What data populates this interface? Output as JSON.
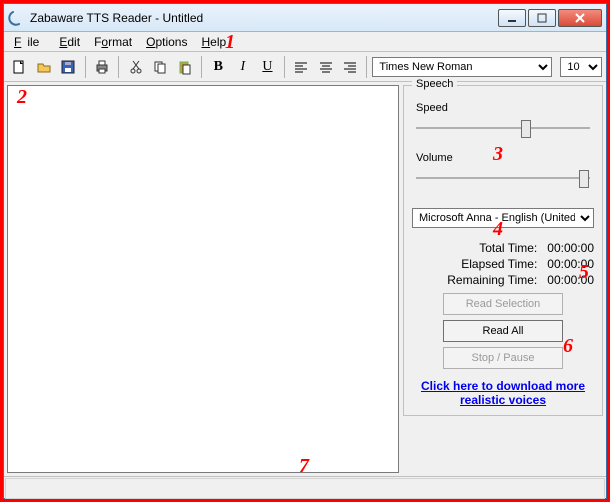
{
  "window": {
    "title": "Zabaware TTS Reader - Untitled"
  },
  "menu": {
    "file": "File",
    "edit": "Edit",
    "format": "Format",
    "options": "Options",
    "help": "Help"
  },
  "toolbar": {
    "font_value": "Times New Roman",
    "size_value": "10"
  },
  "speech": {
    "legend": "Speech",
    "speed_label": "Speed",
    "volume_label": "Volume",
    "voice_value": "Microsoft Anna - English (United S",
    "total_label": "Total Time:",
    "total_value": "00:00:00",
    "elapsed_label": "Elapsed Time:",
    "elapsed_value": "00:00:00",
    "remaining_label": "Remaining Time:",
    "remaining_value": "00:00:00",
    "read_selection": "Read Selection",
    "read_all": "Read All",
    "stop_pause": "Stop / Pause",
    "download_link": "Click here to download more realistic voices"
  },
  "annotations": {
    "a1": "1",
    "a2": "2",
    "a3": "3",
    "a4": "4",
    "a5": "5",
    "a6": "6",
    "a7": "7"
  }
}
